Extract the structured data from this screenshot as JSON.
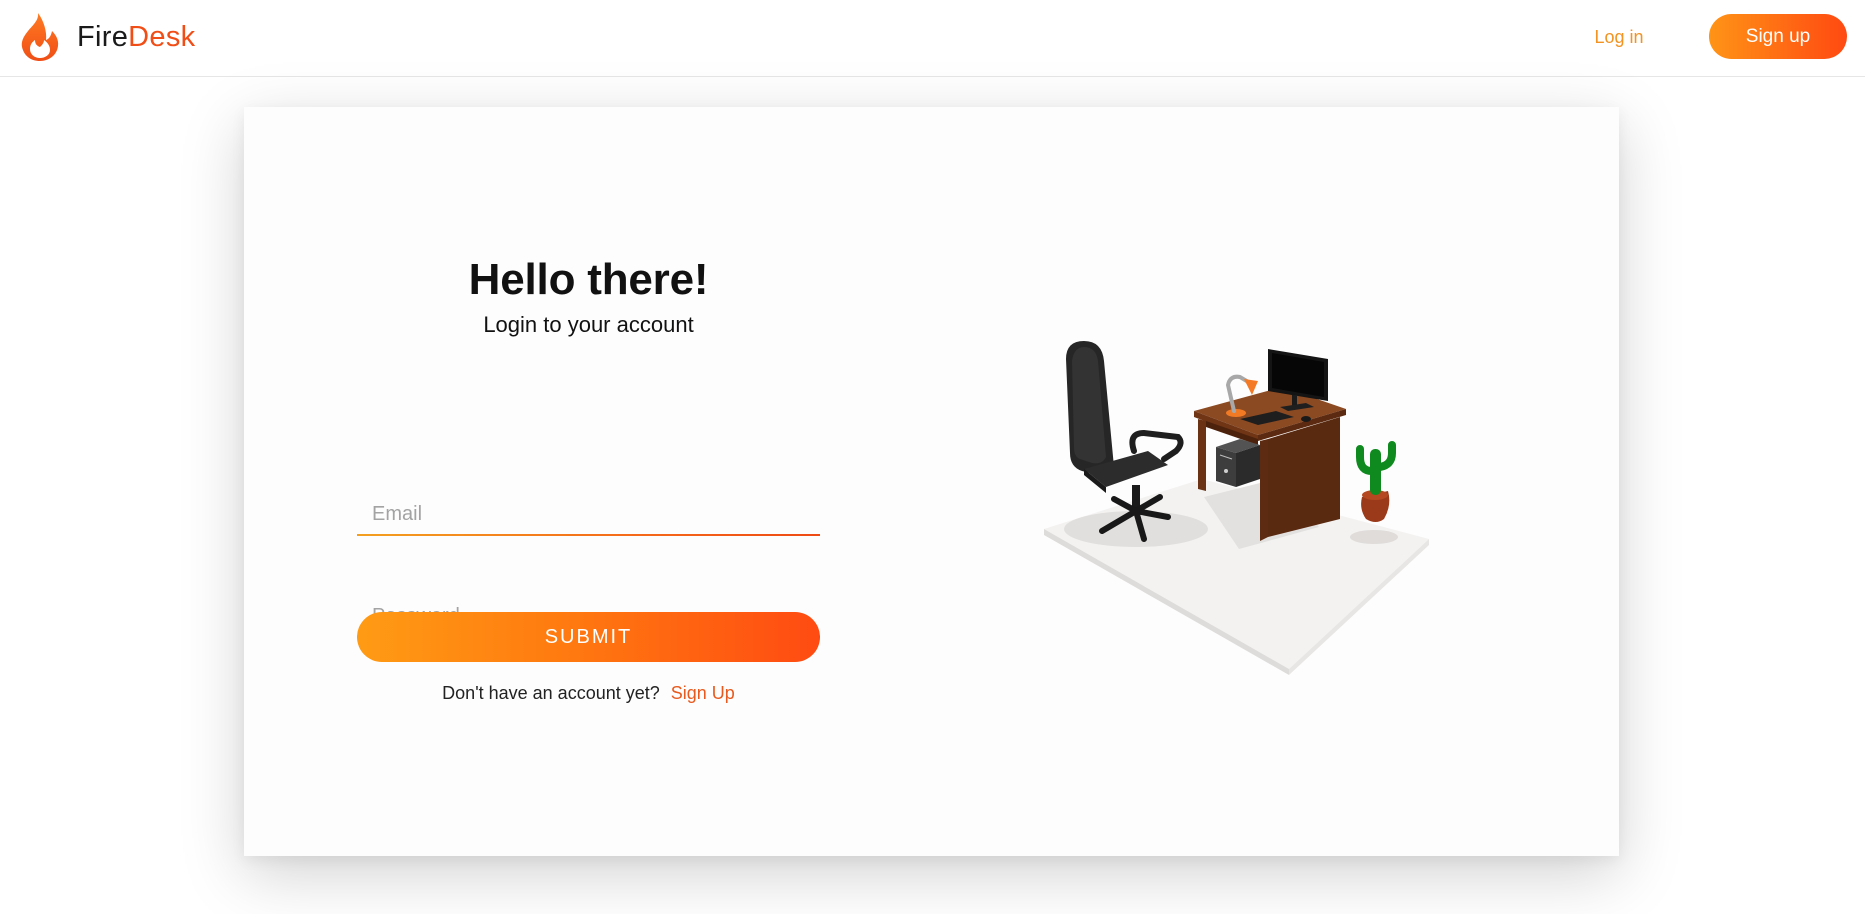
{
  "header": {
    "brand_part1": "Fire",
    "brand_part2": "Desk",
    "login_label": "Log in",
    "signup_label": "Sign up"
  },
  "login": {
    "title": "Hello there!",
    "subtitle": "Login to your account",
    "email_placeholder": "Email",
    "email_value": "",
    "password_placeholder": "Password",
    "password_value": "",
    "submit_label": "SUBMIT",
    "signup_prompt": "Don't have an account yet?",
    "signup_link": "Sign Up"
  },
  "illustration": {
    "alt": "3D office desk with chair, monitor, lamp, computer case and cactus"
  },
  "icons": {
    "logo": "flame-icon"
  },
  "colors": {
    "brand_orange": "#f04e16",
    "accent_orange": "#f39321",
    "gradient_start": "#ff9b14",
    "gradient_end": "#ff4b12",
    "card_bg": "#fefdfd"
  }
}
